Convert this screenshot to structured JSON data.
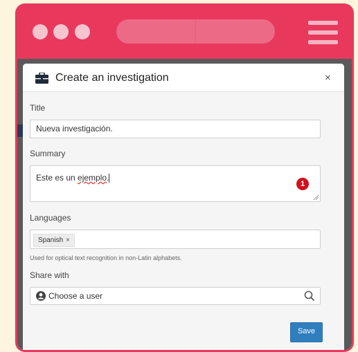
{
  "modal": {
    "title": "Create an investigation",
    "close_label": "×",
    "fields": {
      "title": {
        "label": "Title",
        "value": "Nueva investigación."
      },
      "summary": {
        "label": "Summary",
        "value_before": "Este es un ",
        "value_misspelled": "ejemplo",
        "value_after": ".",
        "error_count": "1"
      },
      "languages": {
        "label": "Languages",
        "tags": [
          {
            "label": "Spanish",
            "remove": "×"
          }
        ],
        "hint": "Used for optical text recognition in non-Latin alphabets."
      },
      "share": {
        "label": "Share with",
        "placeholder": "Choose a user"
      }
    },
    "save_label": "Save"
  },
  "colors": {
    "brand": "#e8395d",
    "primary_button": "#2f7fbf",
    "error_badge": "#d0121e"
  }
}
